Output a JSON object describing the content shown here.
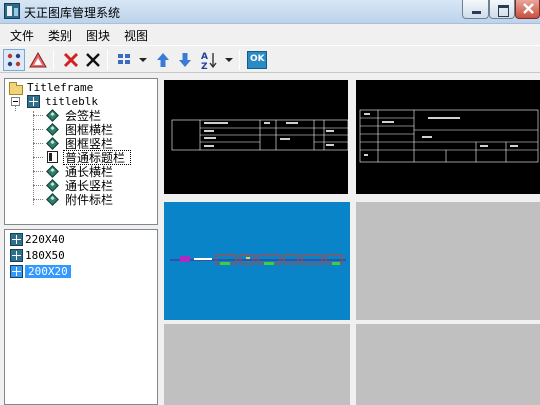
{
  "window": {
    "title": "天正图库管理系统",
    "colors": {
      "titlebar": "#bcd3ec",
      "selection": "#3399ff",
      "preview_selected": "#0a84c8",
      "preview_empty": "#c0c0c0"
    }
  },
  "menu": {
    "items": [
      {
        "label": "文件"
      },
      {
        "label": "类别"
      },
      {
        "label": "图块"
      },
      {
        "label": "视图"
      }
    ]
  },
  "toolbar": {
    "ok_label": "OK",
    "icons": [
      "sort-grid-icon",
      "triangle-tool-icon",
      "delete-red-x-icon",
      "delete-black-x-icon",
      "view-layout-icon",
      "move-up-icon",
      "move-down-icon",
      "sort-az-icon",
      "ok-icon"
    ]
  },
  "tree": {
    "root": "Titleframe",
    "child": "titleblk",
    "items": [
      {
        "label": "会签栏"
      },
      {
        "label": "图框横栏"
      },
      {
        "label": "图框竖栏"
      },
      {
        "label": "普通标题栏"
      },
      {
        "label": "通长横栏"
      },
      {
        "label": "通长竖栏"
      },
      {
        "label": "附件标栏"
      }
    ],
    "selected": "普通标题栏"
  },
  "blocks": {
    "items": [
      {
        "label": "220X40"
      },
      {
        "label": "180X50"
      },
      {
        "label": "200X20"
      }
    ],
    "selected": "200X20"
  },
  "preview": {
    "cells": [
      "titleblock-220X40",
      "titleblock-180X50",
      "titleblock-200X20",
      "empty",
      "empty",
      "empty"
    ]
  }
}
